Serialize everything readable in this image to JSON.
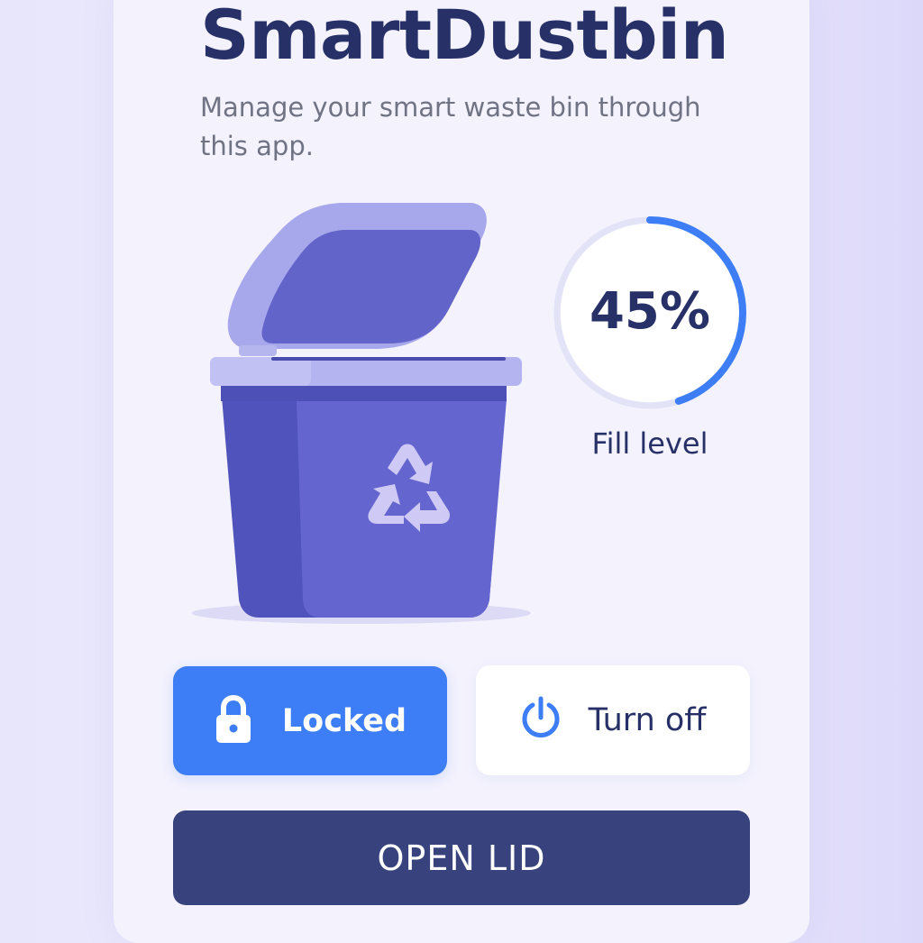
{
  "app": {
    "title": "SmartDustbin",
    "subtitle": "Manage your smart waste bin through this app."
  },
  "fill_level": {
    "value_text": "45%",
    "fraction": 0.45,
    "label": "Fill level"
  },
  "controls": {
    "lock_label": "Locked",
    "power_label": "Turn off",
    "open_lid_label": "OPEN LID"
  },
  "icons": {
    "lock": "lock-icon",
    "power": "power-icon",
    "recycle": "recycle-icon",
    "bin": "trash-bin-icon"
  },
  "colors": {
    "primary_text": "#283167",
    "accent_blue": "#3d7ef6",
    "bin_purple": "#5e62c9",
    "open_button": "#38437e",
    "gauge_track": "#e3e3f8"
  }
}
